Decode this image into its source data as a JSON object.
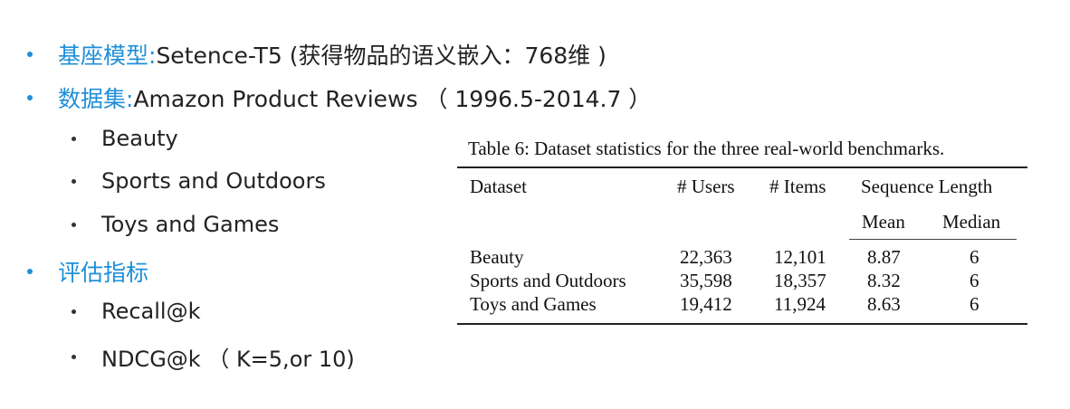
{
  "bullets": {
    "b1_label": "基座模型:",
    "b1_text": " Setence-T5 (获得物品的语义嵌入：768维 )",
    "b2_label": "数据集:",
    "b2_text": " Amazon Product Reviews （ 1996.5-2014.7 ）",
    "b2_sub": [
      "Beauty",
      "Sports and Outdoors",
      "Toys and Games"
    ],
    "b3_label": "评估指标",
    "b3_sub": [
      "Recall@k",
      "NDCG@k （ K=5,or 10)"
    ]
  },
  "table": {
    "caption": "Table 6: Dataset statistics for the three real-world benchmarks.",
    "headers": {
      "dataset": "Dataset",
      "users": "# Users",
      "items": "# Items",
      "seq": "Sequence Length",
      "mean": "Mean",
      "median": "Median"
    },
    "rows": [
      {
        "dataset": "Beauty",
        "users": "22,363",
        "items": "12,101",
        "mean": "8.87",
        "median": "6"
      },
      {
        "dataset": "Sports and Outdoors",
        "users": "35,598",
        "items": "18,357",
        "mean": "8.32",
        "median": "6"
      },
      {
        "dataset": "Toys and Games",
        "users": "19,412",
        "items": "11,924",
        "mean": "8.63",
        "median": "6"
      }
    ]
  }
}
